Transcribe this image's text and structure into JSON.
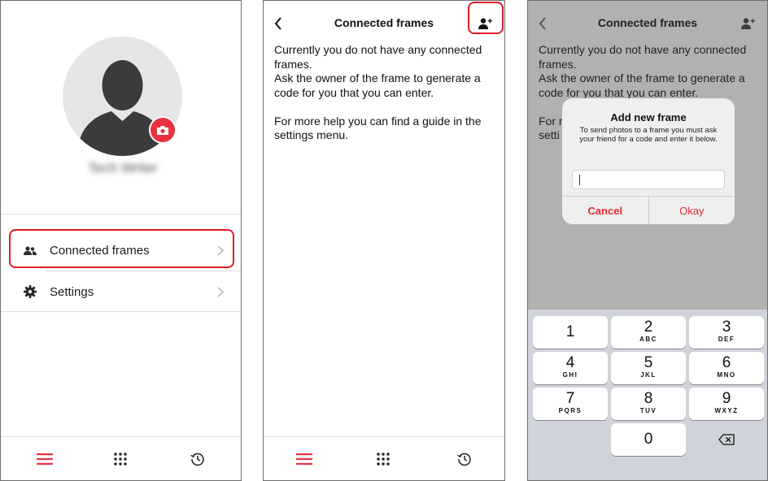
{
  "colors": {
    "accent": "#e8323f",
    "highlight": "#e01b24",
    "alert_button": "#e32b34"
  },
  "profile": {
    "avatar_icon": "user-silhouette",
    "camera_icon": "camera-icon",
    "name": "Tech Writer"
  },
  "menu": {
    "items": [
      {
        "label": "Connected frames",
        "icon": "people-icon"
      },
      {
        "label": "Settings",
        "icon": "gear-icon"
      }
    ]
  },
  "tabbar": {
    "items": [
      "menu-icon",
      "grid-icon",
      "history-icon"
    ]
  },
  "connected": {
    "title": "Connected frames",
    "paragraph1": "Currently you do not have any connected frames.",
    "paragraph2": "Ask the owner of the frame to generate a code for you that you can enter.",
    "paragraph3": "For more help you can find a guide in the settings menu."
  },
  "dialog": {
    "title": "Add new frame",
    "message": "To send photos to a frame you must ask your friend for a code and enter it below.",
    "input_value": "",
    "cancel": "Cancel",
    "ok": "Okay"
  },
  "dimmed_text": {
    "line4a": "For m",
    "line4b": "setti"
  },
  "keypad": {
    "keys": [
      {
        "digit": "1",
        "letters": ""
      },
      {
        "digit": "2",
        "letters": "ABC"
      },
      {
        "digit": "3",
        "letters": "DEF"
      },
      {
        "digit": "4",
        "letters": "GHI"
      },
      {
        "digit": "5",
        "letters": "JKL"
      },
      {
        "digit": "6",
        "letters": "MNO"
      },
      {
        "digit": "7",
        "letters": "PQRS"
      },
      {
        "digit": "8",
        "letters": "TUV"
      },
      {
        "digit": "9",
        "letters": "WXYZ"
      },
      {
        "digit": "0",
        "letters": ""
      }
    ]
  }
}
